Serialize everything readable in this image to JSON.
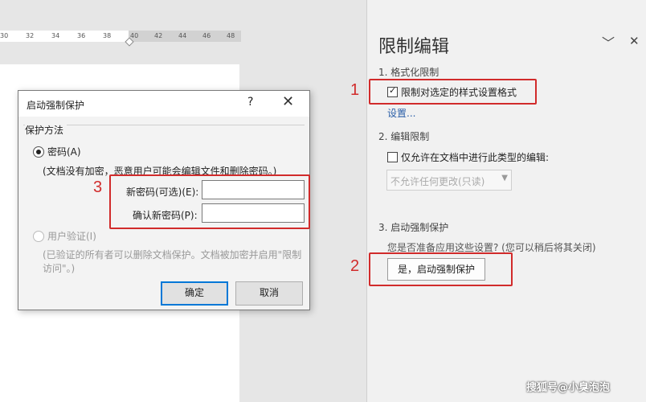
{
  "ruler": {
    "ticks": [
      "30",
      "32",
      "34",
      "36",
      "38",
      "40",
      "42",
      "44",
      "46",
      "48"
    ]
  },
  "dialog": {
    "title": "启动强制保护",
    "help_label": "?",
    "close_label": "✕",
    "group_label": "保护方法",
    "password_option": "密码(A)",
    "password_note": "(文档没有加密，恶意用户可能会编辑文件和删除密码。)",
    "new_password_label": "新密码(可选)(E):",
    "new_password_value": "",
    "confirm_password_label": "确认新密码(P):",
    "confirm_password_value": "",
    "user_auth_option": "用户验证(I)",
    "user_auth_note": "(已验证的所有者可以删除文档保护。文档被加密并启用\"限制访问\"。)",
    "ok_label": "确定",
    "cancel_label": "取消"
  },
  "panel": {
    "title": "限制编辑",
    "collapse_label": "﹀",
    "close_label": "✕",
    "section1_title": "1. 格式化限制",
    "format_checkbox_label": "限制对选定的样式设置格式",
    "format_checked": true,
    "settings_link": "设置...",
    "section2_title": "2. 编辑限制",
    "edit_checkbox_label": "仅允许在文档中进行此类型的编辑:",
    "edit_checked": false,
    "edit_combo_value": "不允许任何更改(只读)",
    "section3_title": "3. 启动强制保护",
    "section3_prompt": "您是否准备应用这些设置? (您可以稍后将其关闭)",
    "start_button": "是，启动强制保护"
  },
  "annotations": {
    "marker1": "1",
    "marker2": "2",
    "marker3": "3"
  },
  "watermark": "搜狐号@小臭泡泡",
  "colors": {
    "annotation_red": "#d12b2b",
    "accent": "#0078d7"
  }
}
